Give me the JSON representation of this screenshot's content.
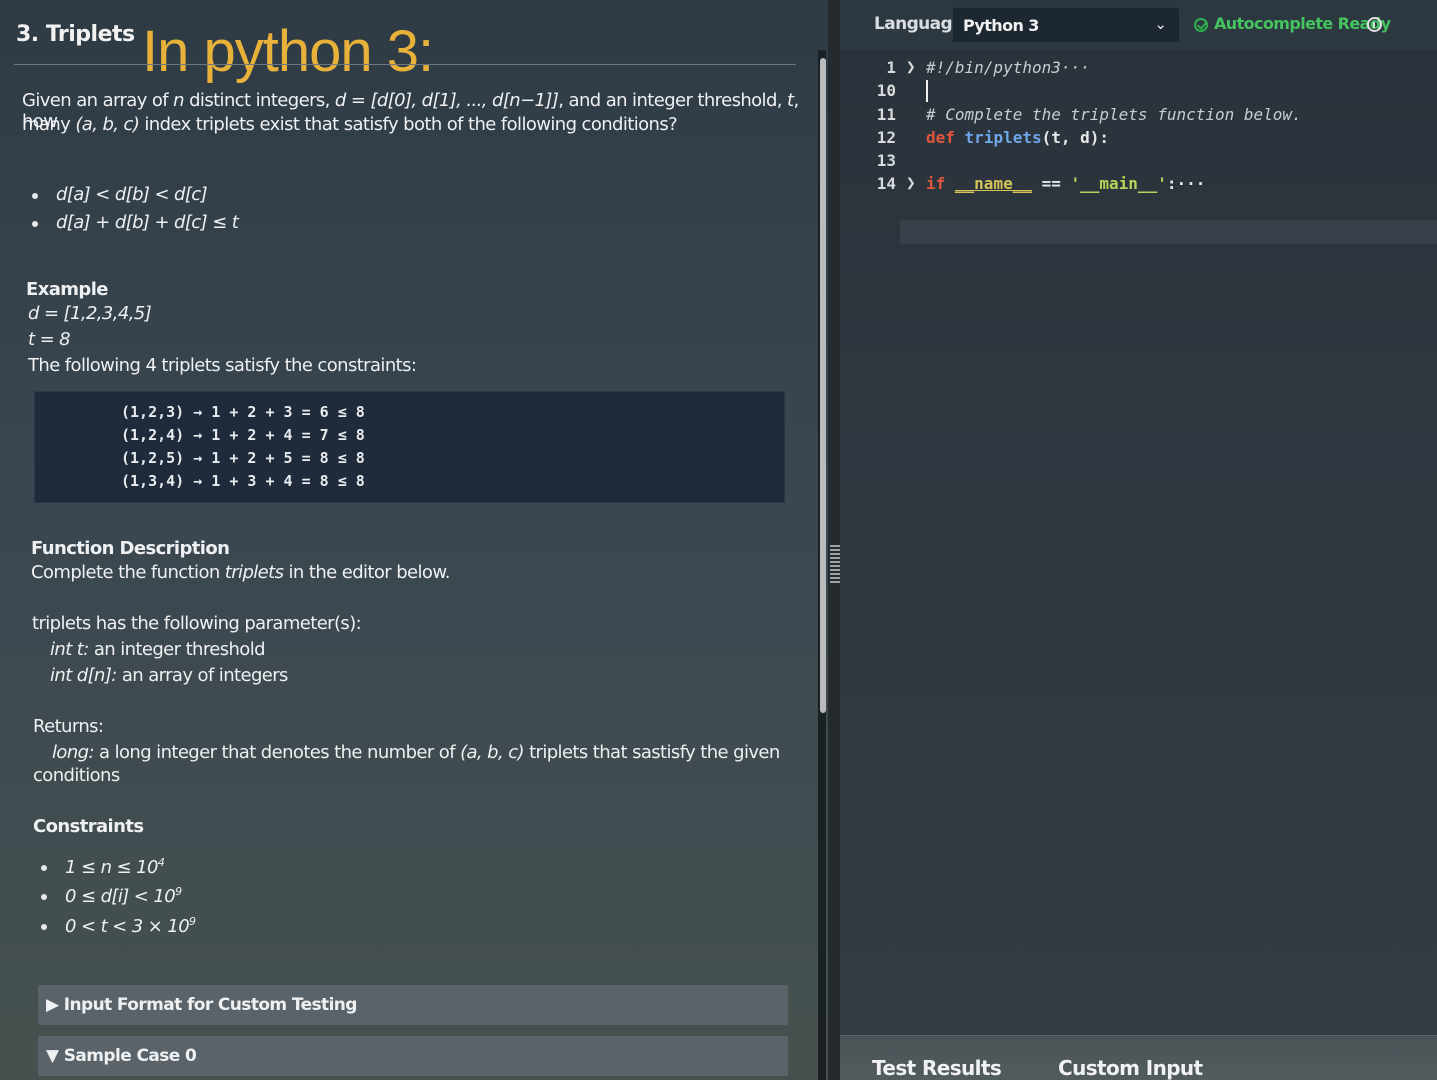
{
  "problem": {
    "title": "3. Triplets",
    "handwritten_note": "In python 3:",
    "desc_line1_pre": "Given an array of ",
    "desc_line1_n": "n",
    "desc_line1_mid": " distinct integers, ",
    "desc_line1_d": "d = [d[0], d[1], ..., d[n−1]]",
    "desc_line1_post": ", and an integer threshold, ",
    "desc_line1_t": "t",
    "desc_line1_end": ", how",
    "desc_line2_pre": "many ",
    "desc_line2_abc": "(a, b, c)",
    "desc_line2_post": " index triplets exist that satisfy both of the following conditions?",
    "conditions": [
      "d[a] < d[b] < d[c]",
      "d[a] + d[b] + d[c] ≤ t"
    ],
    "example_heading": "Example",
    "example_d": "d = [1,2,3,4,5]",
    "example_t": "t = 8",
    "example_text": "The following 4 triplets satisfy the constraints:",
    "example_lines": [
      "(1,2,3) → 1 + 2 + 3 = 6 ≤ 8",
      "(1,2,4) → 1 + 2 + 4 = 7 ≤ 8",
      "(1,2,5) → 1 + 2 + 5 = 8 ≤ 8",
      "(1,3,4) → 1 + 3 + 4 = 8 ≤ 8"
    ],
    "function_heading": "Function Description",
    "function_text_pre": "Complete the function ",
    "function_text_name": "triplets",
    "function_text_post": " in the editor below.",
    "params_heading": "triplets has the following parameter(s):",
    "param1_name": "int t:",
    "param1_desc": " an integer threshold",
    "param2_name": "int d[n]:",
    "param2_desc": " an array of integers",
    "returns_heading": "Returns:",
    "returns_type": "long:",
    "returns_desc_pre": " a long integer that denotes the number of ",
    "returns_desc_abc": "(a, b, c)",
    "returns_desc_post": " triplets that sastisfy the given",
    "returns_desc_line2": "conditions",
    "constraints_heading": "Constraints",
    "constraints": [
      {
        "base": "1 ≤ n ≤ 10",
        "sup": "4"
      },
      {
        "base": "0 ≤ d[i] < 10",
        "sup": "9"
      },
      {
        "base": "0 < t < 3 × 10",
        "sup": "9"
      }
    ],
    "input_format_label": "▶ Input Format for Custom Testing",
    "sample_case_label": "▼ Sample Case 0"
  },
  "editor": {
    "language_label": "Language",
    "language_value": "Python 3",
    "autocomplete_status": "Autocomplete Ready",
    "lines": [
      {
        "num": "1",
        "fold": "❯",
        "code": "#!/bin/python3···"
      },
      {
        "num": "10",
        "fold": "",
        "code": ""
      },
      {
        "num": "11",
        "fold": "",
        "code": "# Complete the triplets function below."
      },
      {
        "num": "12",
        "fold": "",
        "kw": "def",
        "fn": "triplets",
        "rest": "(t, d):"
      },
      {
        "num": "13",
        "fold": "",
        "code": ""
      },
      {
        "num": "14",
        "fold": "❯",
        "kw": "if",
        "dunder": "__name__",
        "op": " == ",
        "str": "'__main__'",
        "rest": ":···"
      }
    ]
  },
  "bottom_tabs": [
    "Test Results",
    "Custom Input"
  ],
  "colors": {
    "accent_green": "#44c35e",
    "handwriting": "#e8b23a",
    "keyword": "#e0563c",
    "function": "#6fa6e8",
    "string": "#b8d45a"
  }
}
